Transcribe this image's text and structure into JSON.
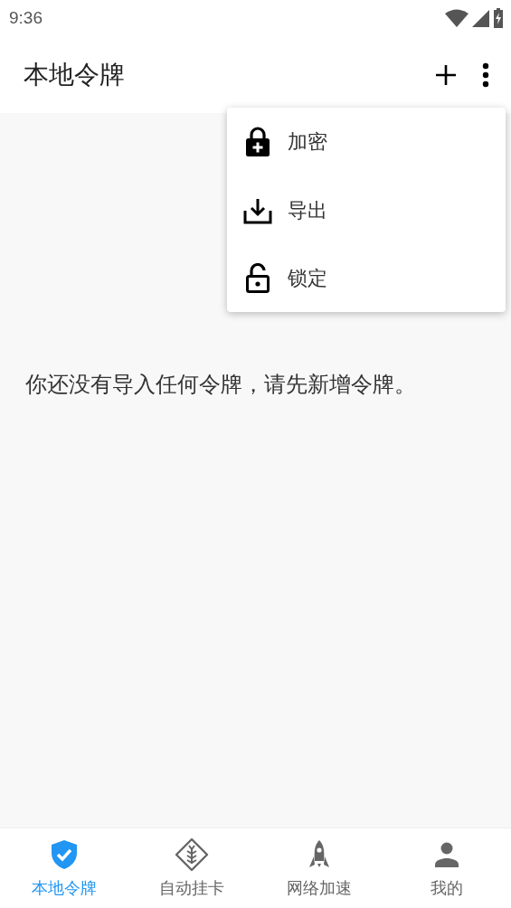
{
  "status_bar": {
    "time": "9:36"
  },
  "app_bar": {
    "title": "本地令牌"
  },
  "menu": {
    "items": [
      {
        "kind": "encrypt",
        "label": "加密"
      },
      {
        "kind": "export",
        "label": "导出"
      },
      {
        "kind": "lock",
        "label": "锁定"
      }
    ]
  },
  "empty_message": "你还没有导入任何令牌，请先新增令牌。",
  "bottom_nav": [
    {
      "kind": "shield",
      "label": "本地令牌",
      "selected": true
    },
    {
      "kind": "wheat",
      "label": "自动挂卡",
      "selected": false
    },
    {
      "kind": "rocket",
      "label": "网络加速",
      "selected": false
    },
    {
      "kind": "person",
      "label": "我的",
      "selected": false
    }
  ]
}
